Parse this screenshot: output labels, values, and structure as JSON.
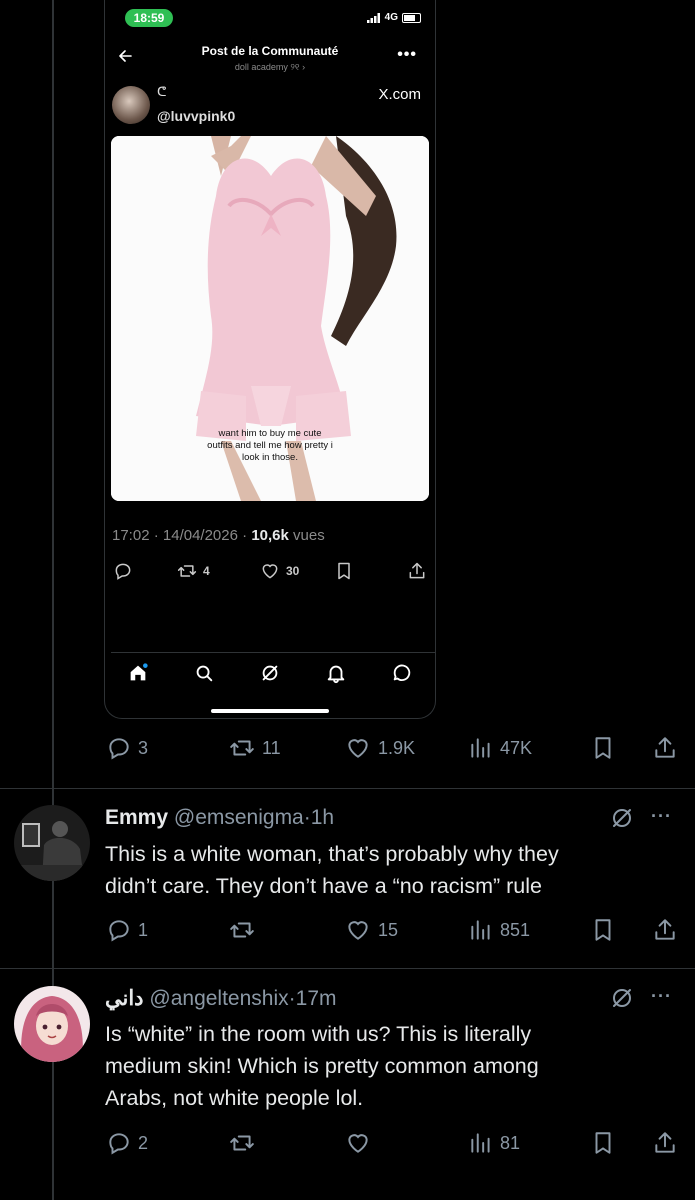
{
  "phone": {
    "status_time": "18:59",
    "network": "4G",
    "header_title": "Post de la Communauté",
    "header_subtitle": "doll academy ୨୧ ›",
    "author_symbol": "ᕦ",
    "author_handle": "@luvvpink0",
    "source_label": "X.com",
    "image_caption": "want him to buy me cute outfits and tell me how pretty i look in those.",
    "post_time": "17:02",
    "post_date": "14/04/2026",
    "views_count": "10,6k",
    "views_label": "vues",
    "reposts": "4",
    "likes": "30",
    "bottom_tabs": [
      "home-icon",
      "search-icon",
      "grok-icon",
      "notifications-icon",
      "messages-icon"
    ]
  },
  "main_post": {
    "replies": "3",
    "reposts": "11",
    "likes": "1.9K",
    "views": "47K"
  },
  "replies": [
    {
      "name": "Emmy",
      "handle": "@emsenigma",
      "sep": "·",
      "time": "1h",
      "text_lines": [
        "This is a white woman, that’s probably why they",
        "didn’t care. They don’t have a “no racism” rule"
      ],
      "replies": "1",
      "reposts": "",
      "likes": "15",
      "views": "851"
    },
    {
      "name": "داني",
      "handle": "@angeltenshix",
      "sep": "·",
      "time": "17m",
      "text_lines": [
        "Is “white” in the room with us? This is literally",
        "medium skin! Which is pretty common among",
        "Arabs, not white people lol."
      ],
      "replies": "2",
      "reposts": "",
      "likes": "",
      "views": "81"
    }
  ],
  "colors": {
    "background": "#000000",
    "text": "#e7e9ea",
    "muted": "#8b98a5",
    "divider": "#2f3336",
    "status_pill": "#2fbf54"
  }
}
